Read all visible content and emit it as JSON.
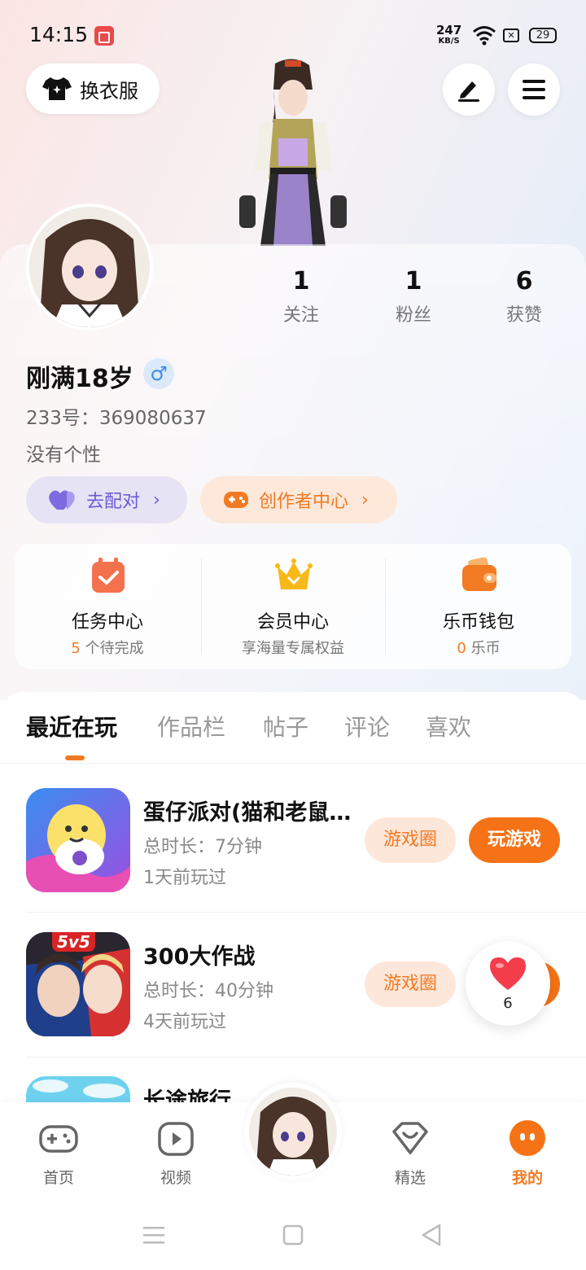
{
  "status_bar": {
    "time": "14:15",
    "speed_value": "247",
    "speed_unit": "KB/S",
    "battery": "29"
  },
  "top": {
    "outfit_label": "换衣服"
  },
  "profile": {
    "stats": [
      {
        "value": "1",
        "label": "关注"
      },
      {
        "value": "1",
        "label": "粉丝"
      },
      {
        "value": "6",
        "label": "获赞"
      }
    ],
    "username": "刚满18岁",
    "gender_symbol": "♂",
    "uid": "233号：369080637",
    "bio": "没有个性",
    "pair_label": "去配对",
    "creator_label": "创作者中心"
  },
  "features": [
    {
      "title": "任务中心",
      "highlight": "5",
      "sub": " 个待完成"
    },
    {
      "title": "会员中心",
      "sub": "享海量专属权益"
    },
    {
      "title": "乐币钱包",
      "highlight": "0",
      "sub": " 乐币"
    }
  ],
  "tabs": [
    "最近在玩",
    "作品栏",
    "帖子",
    "评论",
    "喜欢"
  ],
  "games": [
    {
      "name": "蛋仔派对(猫和老鼠联动)",
      "duration": "总时长：7分钟",
      "last_played": "1天前玩过",
      "circle_label": "游戏圈",
      "play_label": "玩游戏"
    },
    {
      "name": "300大作战",
      "badge": "5v5",
      "duration": "总时长：40分钟",
      "last_played": "4天前玩过",
      "circle_label": "游戏圈"
    },
    {
      "name": "长途旅行"
    }
  ],
  "like_float": {
    "count": "6"
  },
  "bottom_nav": [
    {
      "label": "首页"
    },
    {
      "label": "视频"
    },
    {
      "label": "精选"
    },
    {
      "label": "我的"
    }
  ],
  "colors": {
    "accent": "#f27a22",
    "play_button": "#f57316",
    "pair": "#6b5bd6"
  }
}
